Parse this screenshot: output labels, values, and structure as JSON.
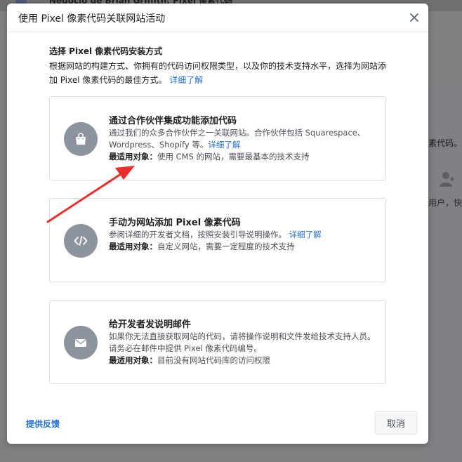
{
  "background": {
    "title": "Negocio de Brian Griffith: Pixel 像素代码",
    "side_text_1": "素代码。",
    "side_text_2": "用户，快"
  },
  "dialog": {
    "title": "使用 Pixel 像素代码关联网站活动",
    "close_icon": "close-icon",
    "section": {
      "title": "选择 Pixel 像素代码安装方式",
      "description": "根据网站的构建方式、你拥有的代码访问权限类型，以及你的技术支持水平，选择为网站添加 Pixel 像素代码的最佳方式。",
      "learn_more": "详细了解"
    },
    "options": [
      {
        "icon": "shopping-bag-icon",
        "title": "通过合作伙伴集成功能添加代码",
        "description": "通过我们的众多合作伙伴之一关联网站。合作伙伴包括 Squarespace、Wordpress、Shopify 等。",
        "learn_more": "详细了解",
        "best_for_label": "最适用对象：",
        "best_for": "使用 CMS 的网站，需要最基本的技术支持"
      },
      {
        "icon": "code-icon",
        "title": "手动为网站添加 Pixel 像素代码",
        "description": "参阅详细的开发者文档，按照安装引导说明操作。",
        "learn_more": "详细了解",
        "best_for_label": "最适用对象：",
        "best_for": "自定义网站，需要一定程度的技术支持"
      },
      {
        "icon": "envelope-icon",
        "title": "给开发者发说明邮件",
        "description": "如果你无法直接获取网站的代码，请将操作说明和文件发给技术支持人员。请务必在邮件中提供 Pixel 像素代码编号。",
        "best_for_label": "最适用对象：",
        "best_for": "目前没有网站代码库的访问权限"
      }
    ],
    "footer": {
      "feedback": "提供反馈",
      "cancel": "取消"
    }
  },
  "colors": {
    "link": "#216fdb",
    "icon_circle": "#8d949e",
    "annotation_arrow": "#e8302a",
    "overlay": "#7f8082"
  }
}
